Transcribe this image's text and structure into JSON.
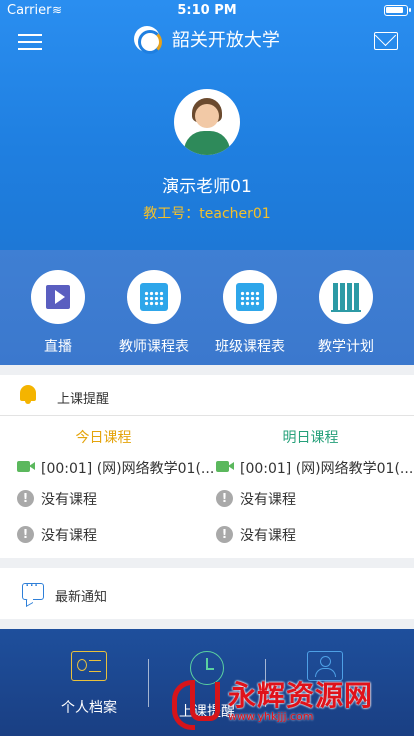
{
  "status_bar": {
    "carrier": "Carrier",
    "wifi": "≋",
    "time": "5:10 PM"
  },
  "header": {
    "title": "韶关开放大学"
  },
  "profile": {
    "name": "演示老师01",
    "id_label": "教工号：",
    "id_value": "teacher01"
  },
  "quick_actions": [
    {
      "label": "直播",
      "icon": "play-icon"
    },
    {
      "label": "教师课程表",
      "icon": "calendar-icon"
    },
    {
      "label": "班级课程表",
      "icon": "calendar-icon"
    },
    {
      "label": "教学计划",
      "icon": "books-icon"
    }
  ],
  "reminder": {
    "title": "上课提醒",
    "today": {
      "heading": "今日课程",
      "items": [
        "[00:01] (网)网络教学01(...",
        "没有课程",
        "没有课程"
      ]
    },
    "tomorrow": {
      "heading": "明日课程",
      "items": [
        "[00:01] (网)网络教学01(...",
        "没有课程",
        "没有课程"
      ]
    }
  },
  "notice": {
    "title": "最新通知"
  },
  "bottom_menu": [
    {
      "label": "个人档案",
      "icon": "id-card-icon"
    },
    {
      "label": "上课提醒",
      "icon": "alarm-clock-icon"
    },
    {
      "label": "",
      "icon": "user-icon"
    }
  ],
  "watermark": {
    "text": "永辉资源网",
    "url": "www.yhkjjj.com"
  },
  "colors": {
    "primary_blue": "#1f7fe0",
    "today_color": "#e4a40c",
    "tomorrow_color": "#26a07a",
    "teacher_id_color": "#f4c02a",
    "bottom_panel": "#1e4f9c"
  }
}
